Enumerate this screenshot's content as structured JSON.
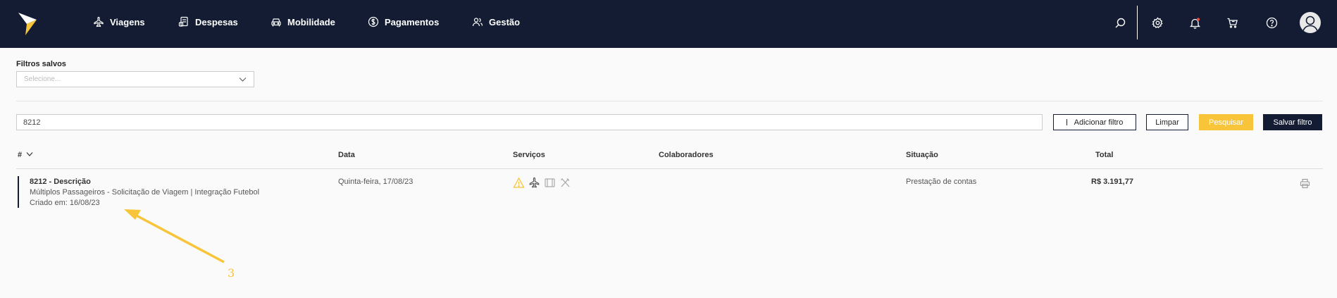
{
  "nav": {
    "items": [
      {
        "label": "Viagens",
        "icon": "airplane-icon"
      },
      {
        "label": "Despesas",
        "icon": "receipt-icon"
      },
      {
        "label": "Mobilidade",
        "icon": "car-icon"
      },
      {
        "label": "Pagamentos",
        "icon": "dollar-circle-icon"
      },
      {
        "label": "Gestão",
        "icon": "users-icon"
      }
    ],
    "actions": [
      "search-icon",
      "gear-icon",
      "bell-icon",
      "cart-icon",
      "help-icon",
      "avatar"
    ]
  },
  "filters": {
    "saved_label": "Filtros salvos",
    "saved_placeholder": "Selecione...",
    "search_value": "8212",
    "add_filter_label": "Adicionar filtro",
    "clear_label": "Limpar",
    "search_label": "Pesquisar",
    "save_filter_label": "Salvar filtro"
  },
  "table": {
    "headers": {
      "number": "#",
      "date": "Data",
      "services": "Serviços",
      "collaborators": "Colaboradores",
      "status": "Situação",
      "total": "Total"
    },
    "rows": [
      {
        "title": "8212 - Descrição",
        "subtitle": "Múltiplos Passageiros - Solicitação de Viagem | Integração Futebol",
        "created": "Criado em: 16/08/23",
        "date": "Quinta-feira, 17/08/23",
        "services": [
          "warning-icon",
          "airplane-icon",
          "hotel-icon",
          "restaurant-icon"
        ],
        "collaborators": "",
        "status": "Prestação de contas",
        "total": "R$ 3.191,77"
      }
    ]
  },
  "annotation": {
    "label": "3",
    "color": "#f8c53a"
  },
  "colors": {
    "navbar": "#131c33",
    "accent": "#f8c53a",
    "notification_dot": "#e74c3c"
  }
}
